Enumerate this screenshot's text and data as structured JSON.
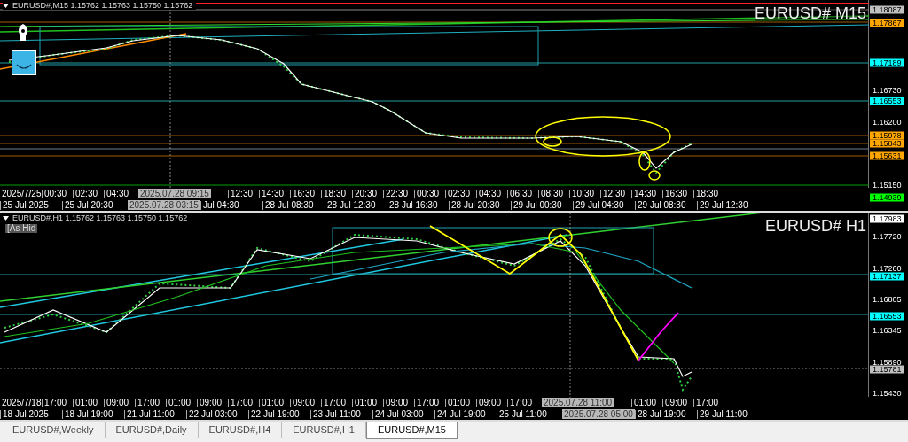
{
  "charts": [
    {
      "header": "EURUSD#,M15 1.15762 1.15763 1.15750 1.15762",
      "title": "EURUSD# M15",
      "price_axis": [
        {
          "kind": "badge",
          "text": "1.18087",
          "color": "#c0c0c0"
        },
        {
          "kind": "badge",
          "text": "1.17867",
          "color": "#ffa500"
        },
        {
          "kind": "badge",
          "text": "1.17189",
          "color": "#00ffff"
        },
        {
          "kind": "tick",
          "text": "1.16730"
        },
        {
          "kind": "badge",
          "text": "1.16553",
          "color": "#00ffff"
        },
        {
          "kind": "tick",
          "text": "1.16200"
        },
        {
          "kind": "badge",
          "text": "1.15978",
          "color": "#ffa500"
        },
        {
          "kind": "badge",
          "text": "1.15843",
          "color": "#ffa500"
        },
        {
          "kind": "badge",
          "text": "1.15631",
          "color": "#ffa500"
        },
        {
          "kind": "tick",
          "text": "1.15150"
        },
        {
          "kind": "badge",
          "text": "1.14939",
          "color": "#00ff00"
        }
      ],
      "time_axis": {
        "row_1": [
          {
            "kind": "start",
            "text": "2025/7/25"
          },
          {
            "kind": "tick",
            "text": "00:30"
          },
          {
            "kind": "tick",
            "text": "02:30"
          },
          {
            "kind": "tick",
            "text": "04:30"
          },
          {
            "kind": "cursor",
            "text": "2025.07.28 09:15"
          },
          {
            "kind": "tick",
            "text": "12:30"
          },
          {
            "kind": "tick",
            "text": "14:30"
          },
          {
            "kind": "tick",
            "text": "16:30"
          },
          {
            "kind": "tick",
            "text": "18:30"
          },
          {
            "kind": "tick",
            "text": "20:30"
          },
          {
            "kind": "tick",
            "text": "22:30"
          },
          {
            "kind": "tick",
            "text": "00:30"
          },
          {
            "kind": "tick",
            "text": "02:30"
          },
          {
            "kind": "tick",
            "text": "04:30"
          },
          {
            "kind": "tick",
            "text": "06:30"
          },
          {
            "kind": "tick",
            "text": "08:30"
          },
          {
            "kind": "tick",
            "text": "10:30"
          },
          {
            "kind": "tick",
            "text": "12:30"
          },
          {
            "kind": "tick",
            "text": "14:30"
          },
          {
            "kind": "tick",
            "text": "16:30"
          },
          {
            "kind": "tick",
            "text": "18:30"
          }
        ],
        "row_2": [
          {
            "kind": "tick",
            "text": "25 Jul 2025"
          },
          {
            "kind": "tick",
            "text": "25 Jul 20:30"
          },
          {
            "kind": "cursor",
            "text": "2025.07.28 03:15"
          },
          {
            "kind": "tick",
            "text": "Jul 04:30"
          },
          {
            "kind": "tick",
            "text": "28 Jul 08:30"
          },
          {
            "kind": "tick",
            "text": "28 Jul 12:30"
          },
          {
            "kind": "tick",
            "text": "28 Jul 16:30"
          },
          {
            "kind": "tick",
            "text": "28 Jul 20:30"
          },
          {
            "kind": "tick",
            "text": "29 Jul 00:30"
          },
          {
            "kind": "tick",
            "text": "29 Jul 04:30"
          },
          {
            "kind": "tick",
            "text": "29 Jul 08:30"
          },
          {
            "kind": "tick",
            "text": "29 Jul 12:30"
          }
        ]
      }
    },
    {
      "header": "EURUSD#,H1 1.15762 1.15763 1.15750 1.15762",
      "title": "EURUSD# H1",
      "label": "[As Hid",
      "price_axis": [
        {
          "kind": "badge",
          "text": "1.17983",
          "color": "#ffffff"
        },
        {
          "kind": "tick",
          "text": "1.17720"
        },
        {
          "kind": "tick",
          "text": "1.17260"
        },
        {
          "kind": "badge",
          "text": "1.17137",
          "color": "#00ffff"
        },
        {
          "kind": "tick",
          "text": "1.16805"
        },
        {
          "kind": "badge",
          "text": "1.16553",
          "color": "#00ffff"
        },
        {
          "kind": "tick",
          "text": "1.16345"
        },
        {
          "kind": "tick",
          "text": "1.15890"
        },
        {
          "kind": "badge",
          "text": "1.15781",
          "color": "#c0c0c0"
        },
        {
          "kind": "tick",
          "text": "1.15430"
        }
      ],
      "time_axis": {
        "row_1": [
          {
            "kind": "start",
            "text": "2025/7/18"
          },
          {
            "kind": "tick",
            "text": "17:00"
          },
          {
            "kind": "tick",
            "text": "01:00"
          },
          {
            "kind": "tick",
            "text": "09:00"
          },
          {
            "kind": "tick",
            "text": "17:00"
          },
          {
            "kind": "tick",
            "text": "01:00"
          },
          {
            "kind": "tick",
            "text": "09:00"
          },
          {
            "kind": "tick",
            "text": "17:00"
          },
          {
            "kind": "tick",
            "text": "01:00"
          },
          {
            "kind": "tick",
            "text": "09:00"
          },
          {
            "kind": "tick",
            "text": "17:00"
          },
          {
            "kind": "tick",
            "text": "01:00"
          },
          {
            "kind": "tick",
            "text": "09:00"
          },
          {
            "kind": "tick",
            "text": "17:00"
          },
          {
            "kind": "tick",
            "text": "01:00"
          },
          {
            "kind": "tick",
            "text": "09:00"
          },
          {
            "kind": "tick",
            "text": "17:00"
          },
          {
            "kind": "cursor",
            "text": "2025.07.28 11:00"
          },
          {
            "kind": "tick",
            "text": "01:00"
          },
          {
            "kind": "tick",
            "text": "09:00"
          },
          {
            "kind": "tick",
            "text": "17:00"
          }
        ],
        "row_2": [
          {
            "kind": "tick",
            "text": "18 Jul 2025"
          },
          {
            "kind": "tick",
            "text": "18 Jul 19:00"
          },
          {
            "kind": "tick",
            "text": "21 Jul 11:00"
          },
          {
            "kind": "tick",
            "text": "22 Jul 03:00"
          },
          {
            "kind": "tick",
            "text": "22 Jul 19:00"
          },
          {
            "kind": "tick",
            "text": "23 Jul 11:00"
          },
          {
            "kind": "tick",
            "text": "24 Jul 03:00"
          },
          {
            "kind": "tick",
            "text": "24 Jul 19:00"
          },
          {
            "kind": "tick",
            "text": "25 Jul 11:00"
          },
          {
            "kind": "cursor",
            "text": "2025.07.28 05:00"
          },
          {
            "kind": "tick",
            "text": "28 Jul 19:00"
          },
          {
            "kind": "tick",
            "text": "29 Jul 11:00"
          }
        ]
      }
    }
  ],
  "tabs": [
    {
      "label": "EURUSD#,Weekly",
      "selected": false
    },
    {
      "label": "EURUSD#,Daily",
      "selected": false
    },
    {
      "label": "EURUSD#,H4",
      "selected": false
    },
    {
      "label": "EURUSD#,H1",
      "selected": false
    },
    {
      "label": "EURUSD#,M15",
      "selected": true
    }
  ]
}
